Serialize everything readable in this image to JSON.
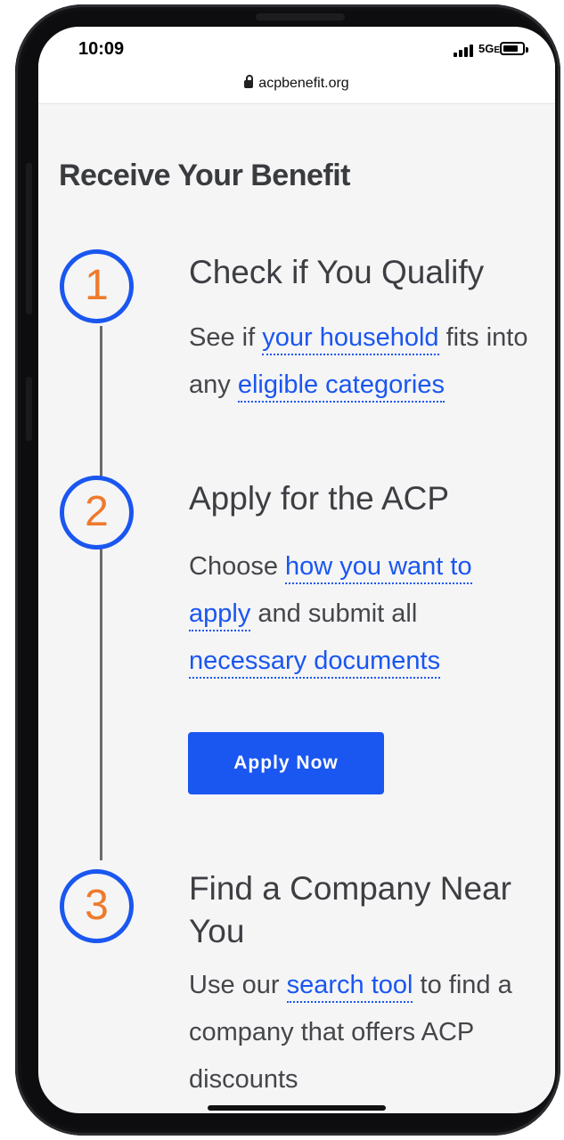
{
  "status_bar": {
    "time": "10:09",
    "network": "5G",
    "network_suffix": "E"
  },
  "browser": {
    "url": "acpbenefit.org"
  },
  "page": {
    "heading": "Receive Your Benefit",
    "steps": [
      {
        "number": "1",
        "title": "Check if You Qualify",
        "body": [
          {
            "text": "See if ",
            "link": false
          },
          {
            "text": "your household",
            "link": true
          },
          {
            "text": " fits into any ",
            "link": false
          },
          {
            "text": "eligible categories",
            "link": true
          }
        ]
      },
      {
        "number": "2",
        "title": "Apply for the ACP",
        "body": [
          {
            "text": "Choose ",
            "link": false
          },
          {
            "text": "how you want to apply",
            "link": true
          },
          {
            "text": " and submit all ",
            "link": false
          },
          {
            "text": "necessary documents",
            "link": true
          }
        ],
        "button": "Apply Now"
      },
      {
        "number": "3",
        "title": "Find a Company Near You",
        "body": [
          {
            "text": "Use our ",
            "link": false
          },
          {
            "text": "search tool",
            "link": true
          },
          {
            "text": " to find a company that offers ACP discounts",
            "link": false
          }
        ]
      }
    ]
  },
  "colors": {
    "accent": "#1a56f0",
    "step_number": "#ee7a2c",
    "background": "#f5f5f6"
  }
}
